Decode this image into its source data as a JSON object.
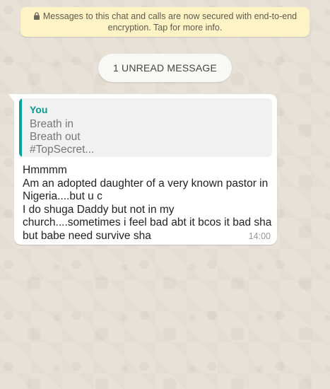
{
  "encryption_banner": {
    "line1": "Messages to this chat and calls are now secured with end-to-end",
    "line2": "encryption. Tap for more info.",
    "icon": "lock-icon"
  },
  "unread_divider": {
    "label": "1 UNREAD MESSAGE"
  },
  "message": {
    "reply_quote": {
      "author": "You",
      "lines": [
        "Breath in",
        "Breath out",
        "#TopSecret..."
      ]
    },
    "lines": [
      "Hmmmm",
      "Am an adopted daughter of a very known pastor in",
      "Nigeria....but u c",
      "I do shuga Daddy but not in my",
      "church....sometimes i feel bad abt it bcos it bad sha",
      "but babe need survive sha"
    ],
    "time": "14:00"
  },
  "colors": {
    "banner_bg": "#fdf3c5",
    "quote_accent": "#06a49a",
    "chat_bg": "#e8e1d7"
  }
}
